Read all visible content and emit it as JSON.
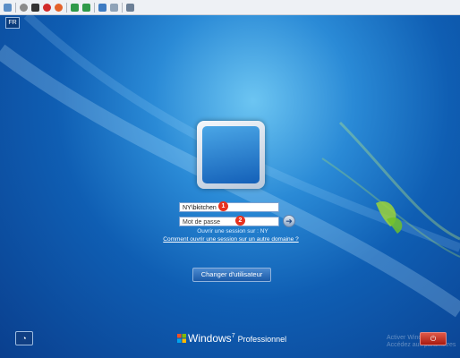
{
  "toolbar": {
    "icons": [
      "settings-icon",
      "stop-icon",
      "shutdown-icon",
      "reset-icon",
      "pause-icon",
      "play-icon",
      "snapshot-icon",
      "revert-icon",
      "enhanced-session-icon"
    ]
  },
  "login": {
    "language": "FR",
    "username": "NY\\bkitchen",
    "password_placeholder": "Mot de passe",
    "marker1": "1",
    "marker2": "2",
    "go_symbol": "➜",
    "logon_to": "Ouvrir une session sur : NY",
    "remote_link": "Comment ouvrir une session sur un autre domaine ?",
    "switch_user": "Changer d'utilisateur"
  },
  "footer": {
    "ease_of_access_symbol": "◔",
    "brand_name": "Windows",
    "brand_version": "7",
    "brand_edition": "Professionnel",
    "watermark_line1": "Activer Windows",
    "watermark_line2": "Accédez aux paramètres",
    "power_symbol": "⏻"
  }
}
